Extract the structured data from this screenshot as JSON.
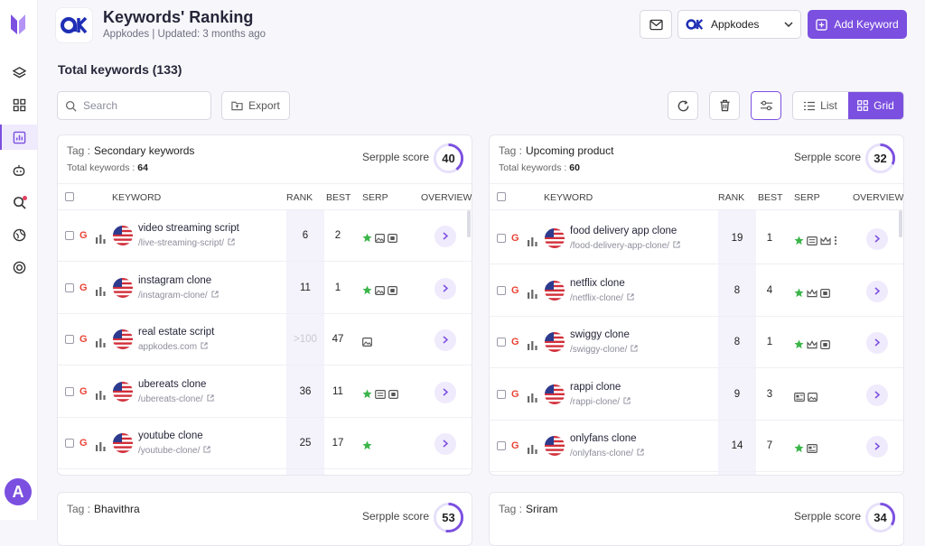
{
  "header": {
    "title": "Keywords' Ranking",
    "subtitle": "Appkodes | Updated: 3 months ago",
    "project": "Appkodes",
    "add_label": "Add Keyword"
  },
  "total_label": "Total keywords (133)",
  "toolbar": {
    "search_placeholder": "Search",
    "export_label": "Export",
    "list_label": "List",
    "grid_label": "Grid"
  },
  "columns": {
    "keyword": "KEYWORD",
    "rank": "RANK",
    "best": "BEST",
    "serp": "SERP",
    "overview": "OVERVIEW"
  },
  "accent": "#7b4fe0",
  "cards": [
    {
      "tag_label": "Tag :",
      "tag": "Secondary keywords",
      "tk_label": "Total keywords :",
      "total_keywords": "64",
      "score_label": "Serpple score",
      "score": "40",
      "score_pct": 0.4,
      "rows": [
        {
          "keyword": "video streaming script",
          "url": "/live-streaming-script/",
          "rank": "6",
          "best": "2",
          "serp": [
            "star-icon",
            "image-icon",
            "video-icon"
          ]
        },
        {
          "keyword": "instagram clone",
          "url": "/instagram-clone/",
          "rank": "11",
          "best": "1",
          "serp": [
            "star-icon",
            "image-icon",
            "video-icon"
          ]
        },
        {
          "keyword": "real estate script",
          "url": "appkodes.com",
          "rank": ">100",
          "best": "47",
          "serp": [
            "image-icon"
          ]
        },
        {
          "keyword": "ubereats clone",
          "url": "/ubereats-clone/",
          "rank": "36",
          "best": "11",
          "serp": [
            "star-icon",
            "ad-icon",
            "video-icon"
          ]
        },
        {
          "keyword": "youtube clone",
          "url": "/youtube-clone/",
          "rank": "25",
          "best": "17",
          "serp": [
            "star-icon"
          ]
        }
      ]
    },
    {
      "tag_label": "Tag :",
      "tag": "Upcoming product",
      "tk_label": "Total keywords :",
      "total_keywords": "60",
      "score_label": "Serpple score",
      "score": "32",
      "score_pct": 0.32,
      "rows": [
        {
          "keyword": "food delivery app clone",
          "url": "/food-delivery-app-clone/",
          "rank": "19",
          "best": "1",
          "serp": [
            "star-icon",
            "ad-icon",
            "crown-icon",
            "more-icon"
          ]
        },
        {
          "keyword": "netflix clone",
          "url": "/netflix-clone/",
          "rank": "8",
          "best": "4",
          "serp": [
            "star-icon",
            "crown-icon",
            "video-icon"
          ]
        },
        {
          "keyword": "swiggy clone",
          "url": "/swiggy-clone/",
          "rank": "8",
          "best": "1",
          "serp": [
            "star-icon",
            "crown-icon",
            "video-icon"
          ]
        },
        {
          "keyword": "rappi clone",
          "url": "/rappi-clone/",
          "rank": "9",
          "best": "3",
          "serp": [
            "news-icon",
            "image-icon"
          ]
        },
        {
          "keyword": "onlyfans clone",
          "url": "/onlyfans-clone/",
          "rank": "14",
          "best": "7",
          "serp": [
            "star-icon",
            "news-icon"
          ]
        }
      ]
    },
    {
      "tag_label": "Tag :",
      "tag": "Bhavithra",
      "score_label": "Serpple score",
      "score": "53",
      "score_pct": 0.53
    },
    {
      "tag_label": "Tag :",
      "tag": "Sriram",
      "score_label": "Serpple score",
      "score": "34",
      "score_pct": 0.34
    }
  ]
}
